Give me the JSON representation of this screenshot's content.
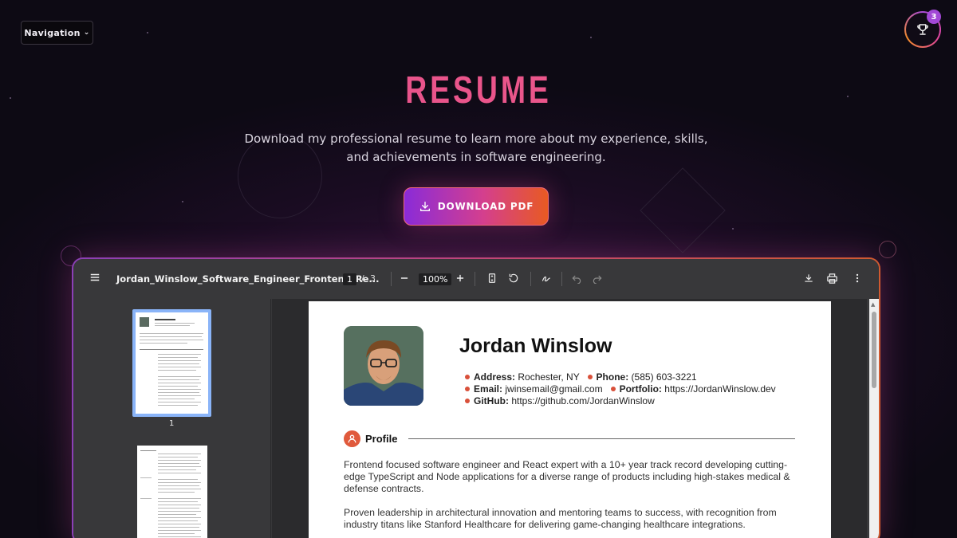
{
  "nav": {
    "label": "Navigation"
  },
  "achievements": {
    "count": "3"
  },
  "hero": {
    "title": "RESUME",
    "subtitle": "Download my professional resume to learn more about my experience, skills, and achievements in software engineering.",
    "download_label": "DOWNLOAD PDF"
  },
  "viewer": {
    "filename": "Jordan_Winslow_Software_Engineer_Frontend_Re...",
    "current_page": "1",
    "page_separator": "/",
    "total_pages": "3",
    "zoom": "100%",
    "thumb_labels": [
      "1"
    ]
  },
  "resume": {
    "name": "Jordan Winslow",
    "contact": {
      "address_label": "Address:",
      "address": "Rochester, NY",
      "phone_label": "Phone:",
      "phone": "(585) 603-3221",
      "email_label": "Email:",
      "email": "jwinsemail@gmail.com",
      "portfolio_label": "Portfolio:",
      "portfolio": "https://JordanWinslow.dev",
      "github_label": "GitHub:",
      "github": "https://github.com/JordanWinslow"
    },
    "profile_heading": "Profile",
    "paragraphs": [
      "Frontend focused software engineer and React expert with a 10+ year track record developing cutting-edge TypeScript and Node applications for a diverse range of products including high-stakes medical & defense contracts.",
      "Proven leadership in architectural innovation and mentoring teams to success, with recognition from industry titans like Stanford Healthcare for delivering game-changing healthcare integrations."
    ]
  },
  "colors": {
    "accent_pink": "#e3508c",
    "accent_purple": "#8a2bd8",
    "accent_orange": "#e85a22",
    "bullet": "#d9503a"
  },
  "icons": [
    "chevron-down-icon",
    "trophy-icon",
    "download-icon",
    "menu-icon",
    "zoom-out-icon",
    "zoom-in-icon",
    "fit-page-icon",
    "rotate-icon",
    "annotate-icon",
    "undo-icon",
    "redo-icon",
    "print-icon",
    "more-icon",
    "user-icon"
  ]
}
